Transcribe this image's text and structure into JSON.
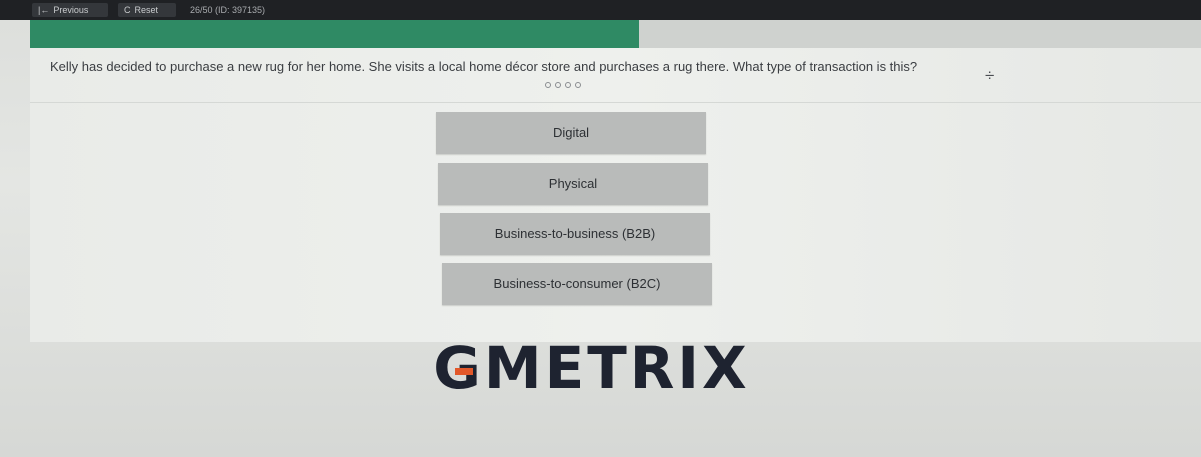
{
  "toolbar": {
    "previous_label": "Previous",
    "previous_glyph": "|←",
    "reset_label": "Reset",
    "reset_glyph": "C",
    "progress_text": "26/50 (ID: 397135)"
  },
  "progress": {
    "fraction": 0.52,
    "color": "#2f8a64"
  },
  "question": {
    "text": "Kelly has decided to purchase a new rug for her home. She visits a local home décor store and purchases a rug there. What type of transaction is this?",
    "tool_icon": "divide-icon",
    "tool_glyph": "÷"
  },
  "options": [
    {
      "label": "Digital"
    },
    {
      "label": "Physical"
    },
    {
      "label": "Business-to-business (B2B)"
    },
    {
      "label": "Business-to-consumer (B2C)"
    }
  ],
  "brand": {
    "logo_text": "GMETRIX",
    "logo_first": "G",
    "logo_rest": "METRIX",
    "accent_color": "#e2582a",
    "text_color": "#1e2330"
  }
}
